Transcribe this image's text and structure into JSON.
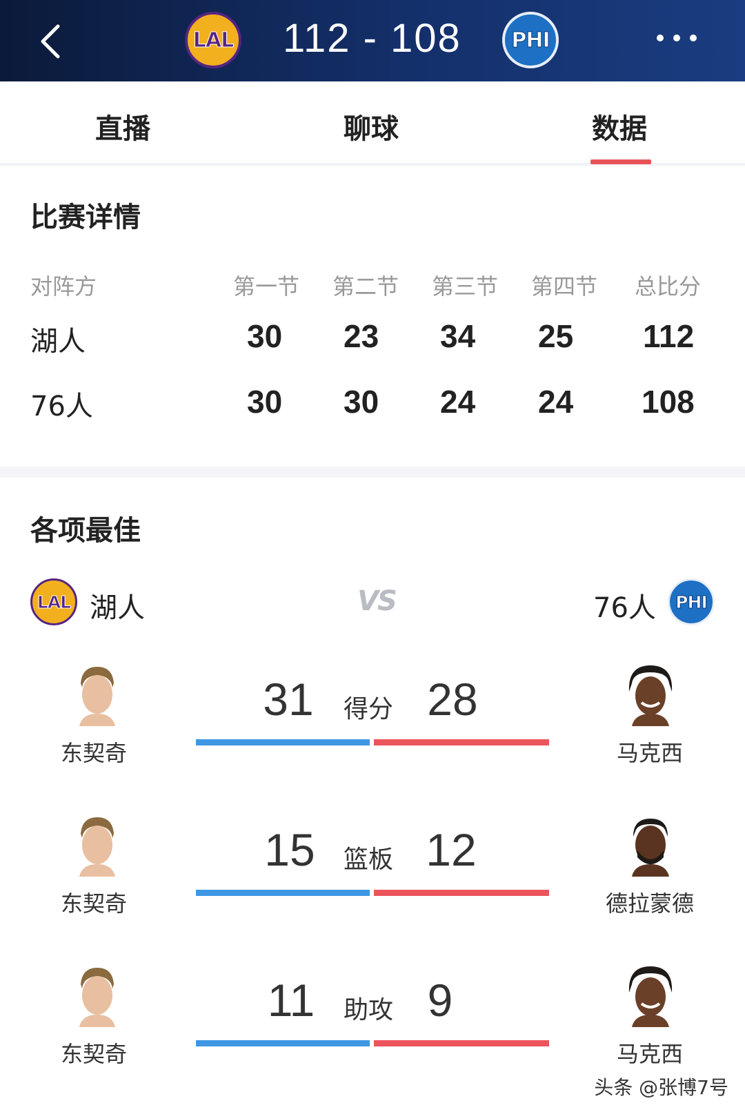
{
  "header": {
    "home_abbr": "LAL",
    "score": "112 - 108",
    "away_abbr": "PHI",
    "back_icon": "chevron-left-icon",
    "more_icon": "more-dots-icon"
  },
  "tabs": [
    {
      "label": "直播"
    },
    {
      "label": "聊球"
    },
    {
      "label": "数据",
      "active": true
    }
  ],
  "match_details": {
    "title": "比赛详情",
    "columns": [
      "对阵方",
      "第一节",
      "第二节",
      "第三节",
      "第四节",
      "总比分"
    ],
    "rows": [
      {
        "team": "湖人",
        "scores": [
          "30",
          "23",
          "34",
          "25",
          "112"
        ]
      },
      {
        "team": "76人",
        "scores": [
          "30",
          "30",
          "24",
          "24",
          "108"
        ]
      }
    ]
  },
  "leaders": {
    "title": "各项最佳",
    "home_team": "湖人",
    "home_logo": "LAL",
    "vs": "VS",
    "away_team": "76人",
    "away_logo": "PHI",
    "stats": [
      {
        "label": "得分",
        "home_player": "东契奇",
        "home_value": "31",
        "away_player": "马克西",
        "away_value": "28"
      },
      {
        "label": "篮板",
        "home_player": "东契奇",
        "home_value": "15",
        "away_player": "德拉蒙德",
        "away_value": "12"
      },
      {
        "label": "助攻",
        "home_player": "东契奇",
        "home_value": "11",
        "away_player": "马克西",
        "away_value": "9"
      }
    ]
  },
  "watermark": "头条 @张博7号",
  "colors": {
    "header_bg": "#14306b",
    "accent_red": "#e8545a",
    "home_bar": "#3f97e4",
    "away_bar": "#ec545c",
    "lakers_gold": "#f2b01e",
    "lakers_purple": "#552583",
    "sixers_blue": "#1d70c4"
  }
}
